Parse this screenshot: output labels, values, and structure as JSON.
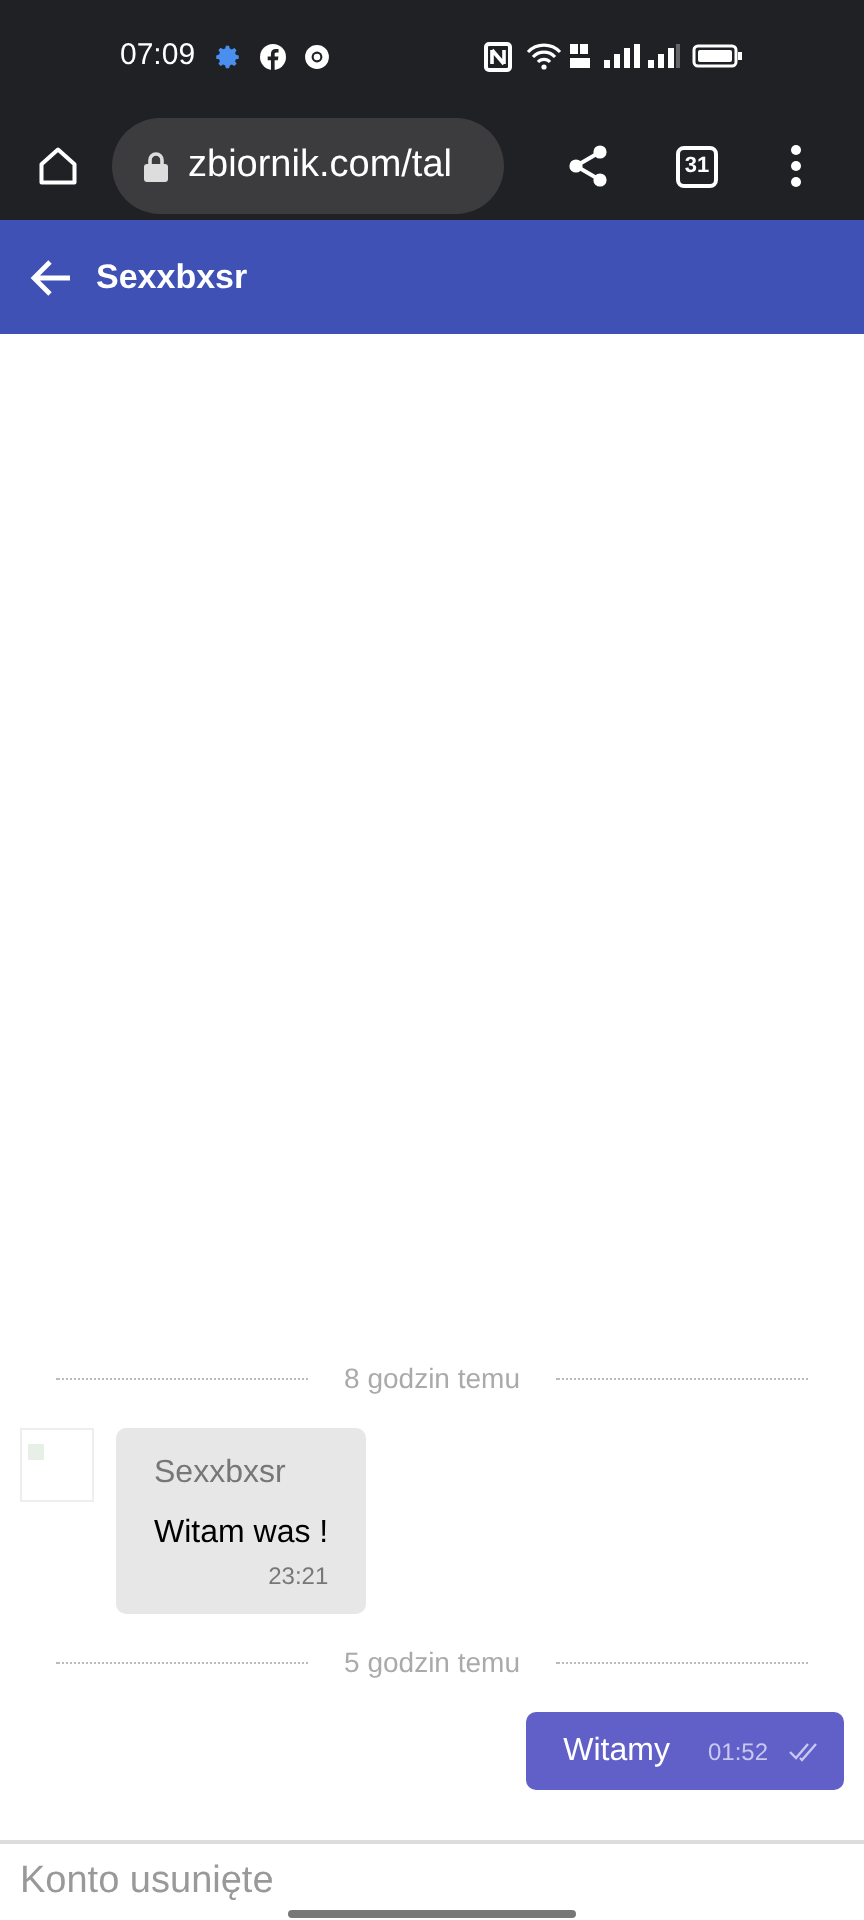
{
  "status_bar": {
    "time": "07:09"
  },
  "browser": {
    "url": "zbiornik.com/tal",
    "tab_count": "31"
  },
  "app_bar": {
    "title": "Sexxbxsr"
  },
  "messages": [
    {
      "kind": "separator",
      "text": "8 godzin temu"
    },
    {
      "kind": "incoming",
      "author": "Sexxbxsr",
      "text": "Witam was !",
      "time": "23:21"
    },
    {
      "kind": "separator",
      "text": "5 godzin temu"
    },
    {
      "kind": "outgoing",
      "text": "Witamy",
      "time": "01:52",
      "read": true
    }
  ],
  "composer": {
    "placeholder": "Konto usunięte"
  }
}
